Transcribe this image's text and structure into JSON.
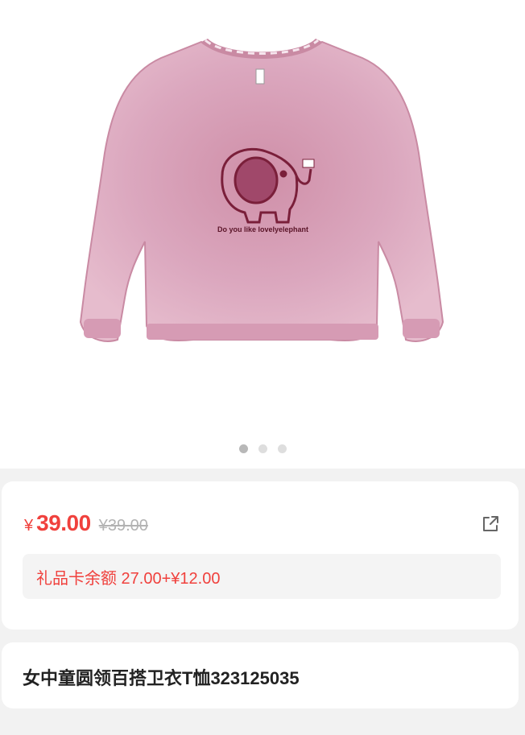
{
  "product": {
    "currency_symbol": "¥",
    "price": "39.00",
    "original_price": "¥39.00",
    "gift_card_text": "礼品卡余额 27.00+¥12.00",
    "title": "女中童圆领百搭卫衣T恤323125035"
  },
  "image": {
    "print_text": "Do you like lovelyelephant"
  },
  "carousel": {
    "dots": 3,
    "active_index": 0
  },
  "colors": {
    "accent": "#f0413d",
    "sweater": "#dba7be",
    "print": "#7a1f3a",
    "background": "#f2f2f2"
  },
  "icons": {
    "share": "share-icon"
  }
}
